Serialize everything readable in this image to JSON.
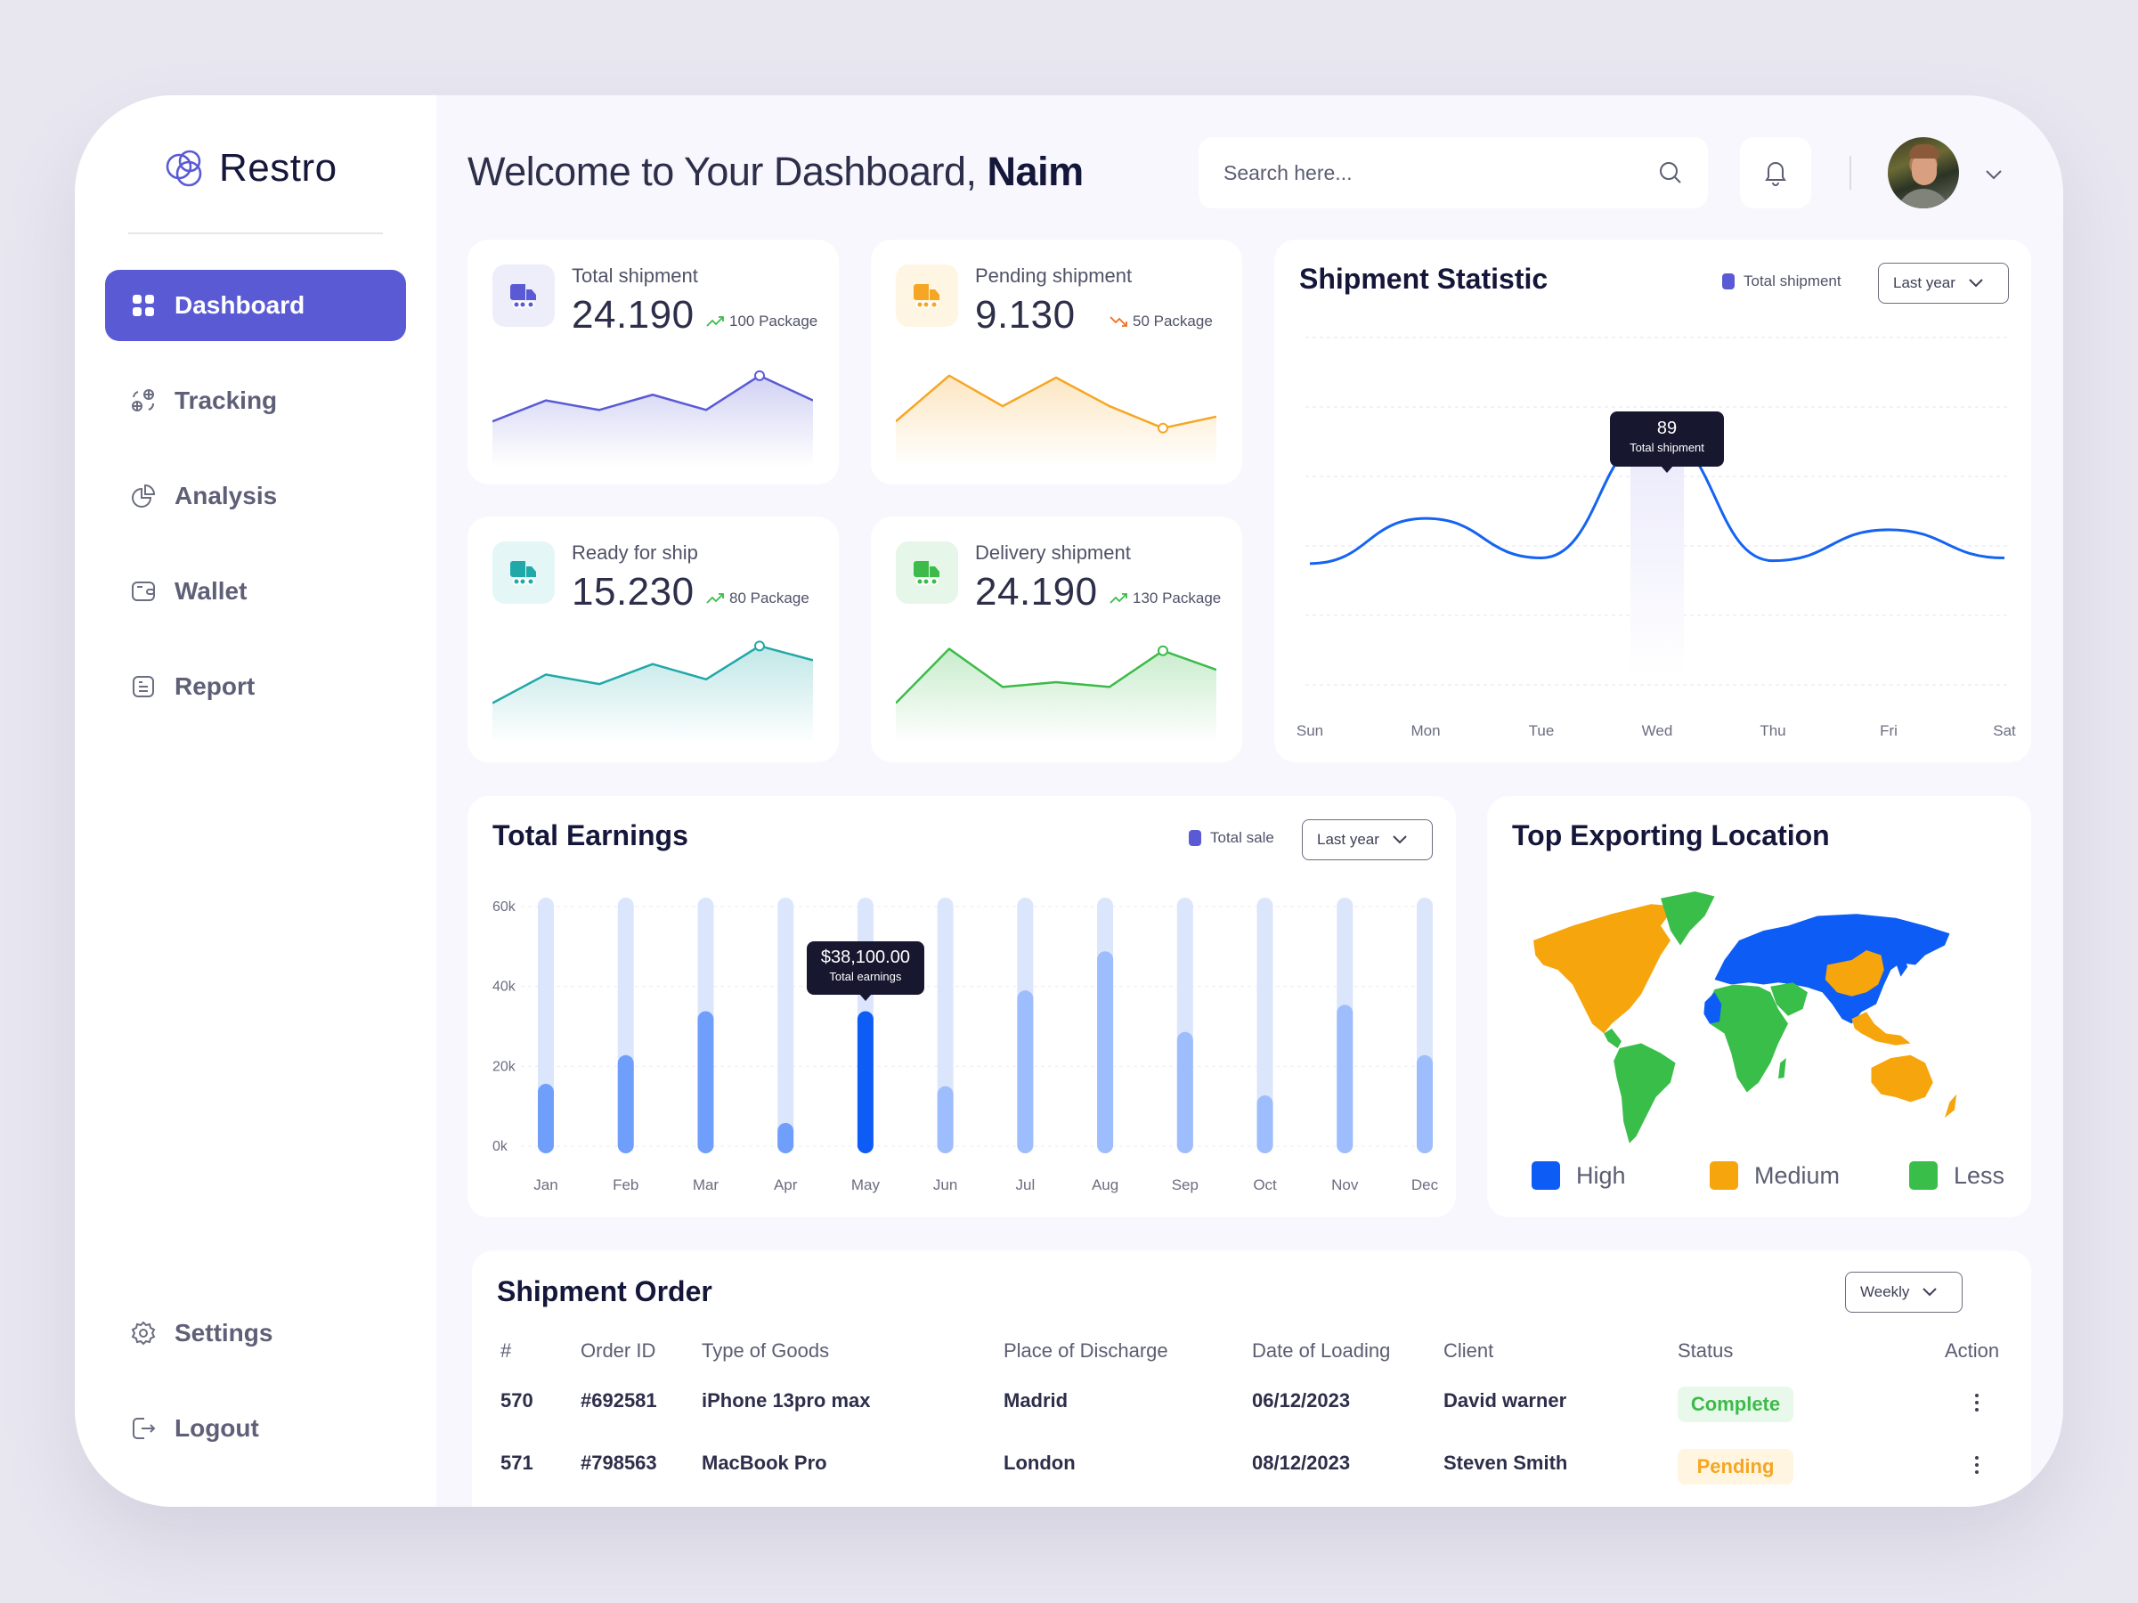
{
  "app": {
    "name": "Restro"
  },
  "sidebar": {
    "items": [
      {
        "label": "Dashboard",
        "icon": "grid-icon",
        "active": true
      },
      {
        "label": "Tracking",
        "icon": "tracking-icon",
        "active": false
      },
      {
        "label": "Analysis",
        "icon": "pie-chart-icon",
        "active": false
      },
      {
        "label": "Wallet",
        "icon": "wallet-icon",
        "active": false
      },
      {
        "label": "Report",
        "icon": "report-icon",
        "active": false
      }
    ],
    "bottom_items": [
      {
        "label": "Settings",
        "icon": "gear-icon"
      },
      {
        "label": "Logout",
        "icon": "logout-icon"
      }
    ]
  },
  "header": {
    "welcome_prefix": "Welcome to Your Dashboard,",
    "user_name": "Naim",
    "search_placeholder": "Search here...",
    "search_value": ""
  },
  "stats": [
    {
      "label": "Total shipment",
      "value": "24.190",
      "delta": "100 Package",
      "trend": "up",
      "color": "#5a5bd4",
      "bg": "#eeeefb",
      "spark": [
        40,
        62,
        52,
        68,
        52,
        88,
        62
      ],
      "marker": 5
    },
    {
      "label": "Pending shipment",
      "value": "9.130",
      "delta": "50 Package",
      "trend": "down",
      "color": "#f5a623",
      "bg": "#fff5e3",
      "spark": [
        40,
        88,
        56,
        86,
        56,
        33,
        45
      ],
      "marker": 5
    },
    {
      "label": "Ready for ship",
      "value": "15.230",
      "delta": "80 Package",
      "trend": "up",
      "color": "#21a8a8",
      "bg": "#e4f6f6",
      "spark": [
        35,
        65,
        55,
        76,
        60,
        95,
        80
      ],
      "marker": 5
    },
    {
      "label": "Delivery shipment",
      "value": "24.190",
      "delta": "130 Package",
      "trend": "up",
      "color": "#3dbb4a",
      "bg": "#e6f6e8",
      "spark": [
        35,
        92,
        52,
        57,
        52,
        90,
        70
      ],
      "marker": 5
    }
  ],
  "trend_colors": {
    "up": "#3dbb4a",
    "down": "#f26d21"
  },
  "shipment_statistic": {
    "title": "Shipment Statistic",
    "legend": "Total shipment",
    "dropdown": "Last year",
    "tooltip": {
      "value": "89",
      "label": "Total shipment"
    },
    "chart_data": {
      "type": "line",
      "title": "Shipment Statistic",
      "categories": [
        "Sun",
        "Mon",
        "Tue",
        "Wed",
        "Thu",
        "Fri",
        "Sat"
      ],
      "series": [
        {
          "name": "Total shipment",
          "values": [
            43,
            59,
            45,
            89,
            44,
            55,
            45
          ]
        }
      ],
      "ylim": [
        0,
        120
      ],
      "grid": true,
      "highlight_index": 3,
      "legend": "top-right"
    }
  },
  "total_earnings": {
    "title": "Total Earnings",
    "legend": "Total sale",
    "dropdown": "Last year",
    "tooltip": {
      "value": "$38,100.00",
      "label": "Total earnings"
    },
    "chart_data": {
      "type": "bar",
      "title": "Total Earnings",
      "categories": [
        "Jan",
        "Feb",
        "Mar",
        "Apr",
        "May",
        "Jun",
        "Jul",
        "Aug",
        "Sep",
        "Oct",
        "Nov",
        "Dec"
      ],
      "series": [
        {
          "name": "Total sale",
          "values": [
            15600,
            22800,
            33800,
            5800,
            38100,
            15000,
            39000,
            48800,
            28600,
            12700,
            35400,
            22800
          ]
        }
      ],
      "yticks": [
        "0k",
        "20k",
        "40k",
        "60k"
      ],
      "ylim": [
        0,
        60000
      ],
      "grid": true,
      "highlight_index": 4,
      "legend": "top-right"
    }
  },
  "top_exporting": {
    "title": "Top Exporting Location",
    "legend": [
      {
        "label": "High",
        "color": "#0c5cf5"
      },
      {
        "label": "Medium",
        "color": "#f7a50c"
      },
      {
        "label": "Less",
        "color": "#39be49"
      }
    ],
    "regions": {
      "high": [
        "Europe",
        "Russia",
        "Central Asia",
        "India",
        "Japan",
        "West Africa (partial)"
      ],
      "medium": [
        "North America",
        "China",
        "Southeast Asia",
        "Australia",
        "New Zealand"
      ],
      "less": [
        "Greenland",
        "South America",
        "Africa",
        "Middle East"
      ]
    }
  },
  "shipment_order": {
    "title": "Shipment Order",
    "dropdown": "Weekly",
    "columns": [
      "#",
      "Order ID",
      "Type of Goods",
      "Place of Discharge",
      "Date of Loading",
      "Client",
      "Status",
      "Action"
    ],
    "rows": [
      {
        "num": "570",
        "order_id": "#692581",
        "goods": "iPhone 13pro max",
        "place": "Madrid",
        "date": "06/12/2023",
        "client": "David warner",
        "status": "Complete"
      },
      {
        "num": "571",
        "order_id": "#798563",
        "goods": "MacBook Pro",
        "place": "London",
        "date": "08/12/2023",
        "client": "Steven Smith",
        "status": "Pending"
      }
    ],
    "status_styles": {
      "Complete": {
        "color": "#3dbb4a",
        "bg": "#e8f8ea"
      },
      "Pending": {
        "color": "#f5a623",
        "bg": "#fff5e0"
      }
    }
  },
  "colors": {
    "accent": "#5a5bd4",
    "line_blue": "#1463f3",
    "bar_light": "#dbe6fd",
    "bar_mid": "#73a1fb",
    "bar_dark": "#0c5cf5"
  }
}
